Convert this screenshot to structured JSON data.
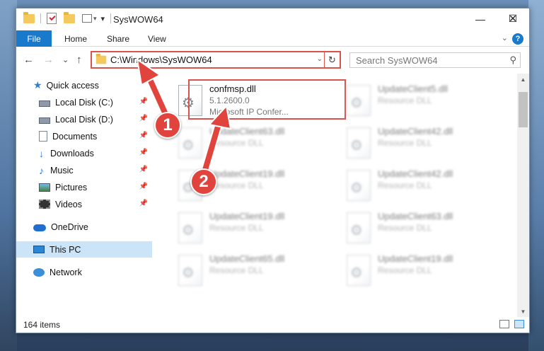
{
  "window": {
    "title": "SysWOW64",
    "minimize_glyph": "—",
    "maximize_glyph": "☐",
    "close_glyph": "✕"
  },
  "ribbon": {
    "tabs": [
      "File",
      "Home",
      "Share",
      "View"
    ],
    "help": "?"
  },
  "address": {
    "path": "C:\\Windows\\SysWOW64",
    "refresh_glyph": "↻"
  },
  "search": {
    "placeholder": "Search SysWOW64"
  },
  "nav": {
    "back": "←",
    "forward": "→",
    "recent": "⌄",
    "up": "↑",
    "items": [
      {
        "label": "Quick access",
        "icon": "star-icon"
      },
      {
        "label": "Local Disk (C:)",
        "icon": "disk-icon",
        "pinned": true
      },
      {
        "label": "Local Disk (D:)",
        "icon": "disk-icon",
        "pinned": true
      },
      {
        "label": "Documents",
        "icon": "document-icon",
        "pinned": true
      },
      {
        "label": "Downloads",
        "icon": "download-icon",
        "pinned": true
      },
      {
        "label": "Music",
        "icon": "music-icon",
        "pinned": true
      },
      {
        "label": "Pictures",
        "icon": "pictures-icon",
        "pinned": true
      },
      {
        "label": "Videos",
        "icon": "video-icon",
        "pinned": true
      },
      {
        "label": "OneDrive",
        "icon": "cloud-icon"
      },
      {
        "label": "This PC",
        "icon": "computer-icon",
        "selected": true
      },
      {
        "label": "Network",
        "icon": "network-icon"
      }
    ]
  },
  "files": [
    {
      "name": "confmsp.dll",
      "line2": "5.1.2600.0",
      "line3": "Microsoft IP Confer...",
      "highlighted": true
    },
    {
      "name": "UpdateClient5.dll",
      "line2": "Resource DLL"
    },
    {
      "name": "UpdateClient63.dll",
      "line2": "Resource DLL"
    },
    {
      "name": "UpdateClient42.dll",
      "line2": "Resource DLL"
    },
    {
      "name": "UpdateClient19.dll",
      "line2": "Resource DLL"
    },
    {
      "name": "UpdateClient42.dll",
      "line2": "Resource DLL"
    },
    {
      "name": "UpdateClient19.dll",
      "line2": "Resource DLL"
    },
    {
      "name": "UpdateClient63.dll",
      "line2": "Resource DLL"
    },
    {
      "name": "UpdateClient65.dll",
      "line2": "Resource DLL"
    },
    {
      "name": "UpdateClient19.dll",
      "line2": "Resource DLL"
    }
  ],
  "status": {
    "item_count": "164 items"
  },
  "callouts": [
    "1",
    "2"
  ],
  "colors": {
    "accent": "#1979ca",
    "highlight_red": "#d9534f",
    "callout_red": "#e0443d"
  }
}
